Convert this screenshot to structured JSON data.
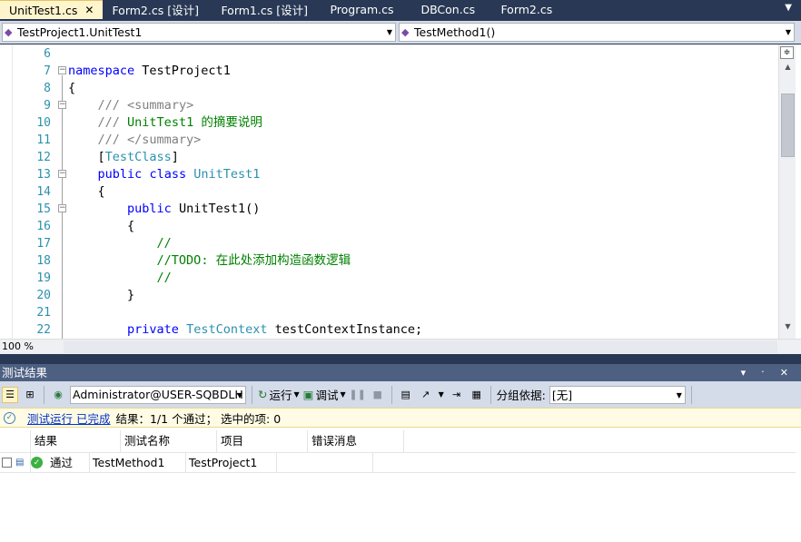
{
  "tabs": [
    {
      "label": "UnitTest1.cs",
      "active": true,
      "close": "✕"
    },
    {
      "label": "Form2.cs [设计]"
    },
    {
      "label": "Form1.cs [设计]"
    },
    {
      "label": "Program.cs"
    },
    {
      "label": "DBCon.cs"
    },
    {
      "label": "Form2.cs"
    }
  ],
  "navbar": {
    "type_combo": "TestProject1.UnitTest1",
    "member_combo": "TestMethod1()"
  },
  "editor": {
    "lines": [
      {
        "n": "6",
        "html": ""
      },
      {
        "n": "7",
        "html": "<span class=\"kw\">namespace</span> TestProject1"
      },
      {
        "n": "8",
        "html": "{"
      },
      {
        "n": "9",
        "html": "    <span class=\"gr\">///</span> <span class=\"gr\">&lt;summary&gt;</span>"
      },
      {
        "n": "10",
        "html": "    <span class=\"gr\">///</span> <span class=\"cm\">UnitTest1 的摘要说明</span>"
      },
      {
        "n": "11",
        "html": "    <span class=\"gr\">/// &lt;/summary&gt;</span>"
      },
      {
        "n": "12",
        "html": "    [<span class=\"ty\">TestClass</span>]"
      },
      {
        "n": "13",
        "html": "    <span class=\"kw\">public</span> <span class=\"kw\">class</span> <span class=\"ty\">UnitTest1</span>"
      },
      {
        "n": "14",
        "html": "    {"
      },
      {
        "n": "15",
        "html": "        <span class=\"kw\">public</span> UnitTest1()"
      },
      {
        "n": "16",
        "html": "        {"
      },
      {
        "n": "17",
        "html": "            <span class=\"cm\">//</span>"
      },
      {
        "n": "18",
        "html": "            <span class=\"cm\">//TODO: 在此处添加构造函数逻辑</span>"
      },
      {
        "n": "19",
        "html": "            <span class=\"cm\">//</span>"
      },
      {
        "n": "20",
        "html": "        }"
      },
      {
        "n": "21",
        "html": ""
      },
      {
        "n": "22",
        "html": "        <span class=\"kw\">private</span> <span class=\"ty\">TestContext</span> testContextInstance;"
      }
    ],
    "zoom": "100 %"
  },
  "results": {
    "title": "测试结果",
    "controls": "▾ ᛫ ✕",
    "user": "Administrator@USER-SQBDLH",
    "run_label": "运行",
    "debug_label": "调试",
    "group_label": "分组依据:",
    "group_value": "[无]",
    "status_link": "测试运行 已完成",
    "status_text": "结果：1/1 个通过；  选中的项: 0",
    "columns": [
      "结果",
      "测试名称",
      "项目",
      "错误消息"
    ],
    "rows": [
      {
        "result": "通过",
        "name": "TestMethod1",
        "project": "TestProject1",
        "error": ""
      }
    ]
  }
}
